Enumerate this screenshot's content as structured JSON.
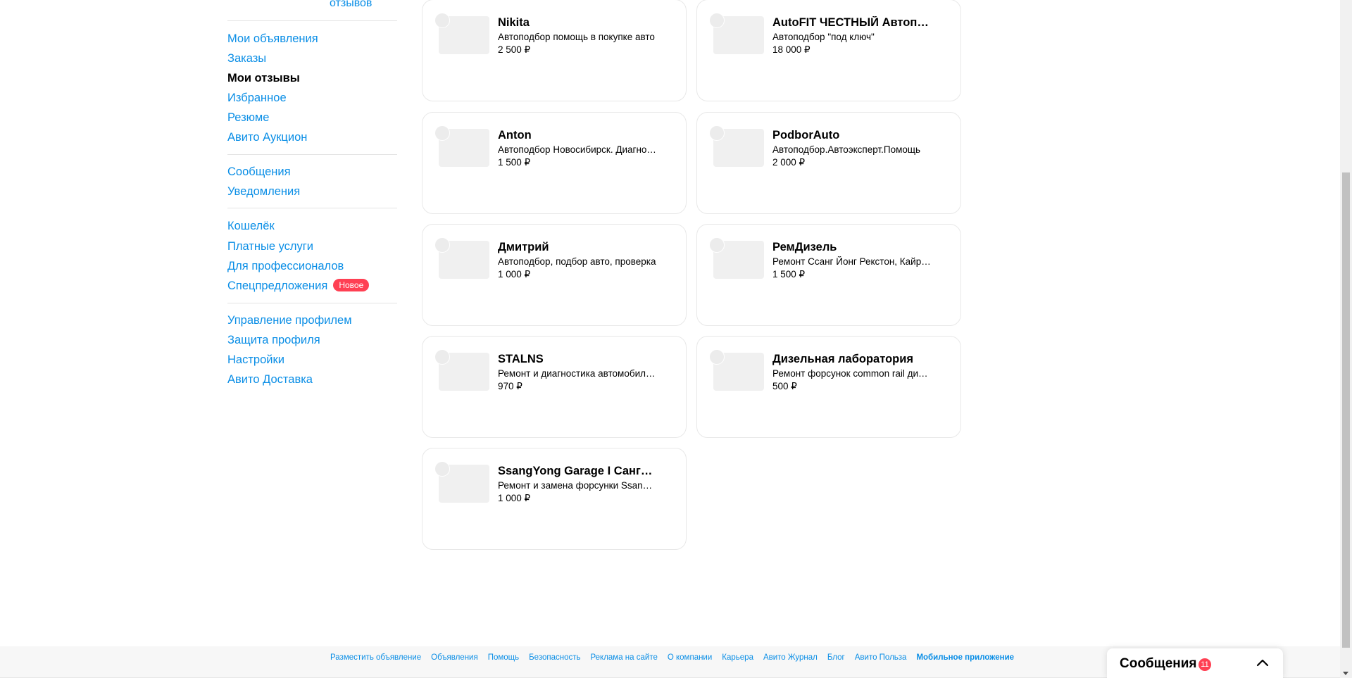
{
  "sidebar": {
    "top_fragment": "отзывов",
    "groups": [
      [
        "Мои объявления",
        "Заказы",
        "Мои отзывы",
        "Избранное",
        "Резюме",
        "Авито Аукцион"
      ],
      [
        "Сообщения",
        "Уведомления"
      ],
      [
        "Кошелёк",
        "Платные услуги",
        "Для профессионалов",
        "Спецпредложения"
      ],
      [
        "Управление профилем",
        "Защита профиля",
        "Настройки",
        "Авито Доставка"
      ]
    ],
    "active_item": "Мои отзывы",
    "new_badge": "Новое"
  },
  "cards": [
    {
      "name": "Nikita",
      "desc": "Автоподбор помощь в покупке авто",
      "price": "2 500 ₽"
    },
    {
      "name": "AutoFIT ЧЕСТНЫЙ Автоподбор",
      "desc": "Автоподбор \"под ключ\"",
      "price": "18 000 ₽"
    },
    {
      "name": "Anton",
      "desc": "Автоподбор Новосибирск. Диагностика",
      "price": "1 500 ₽"
    },
    {
      "name": "PodborAuto",
      "desc": "Автоподбор.Автоэксперт.Помощь",
      "price": "2 000 ₽"
    },
    {
      "name": "Дмитрий",
      "desc": "Автоподбор, подбор авто, проверка",
      "price": "1 000 ₽"
    },
    {
      "name": "РемДизель",
      "desc": "Ремонт Ссанг Йонг Рекстон, Кайрон",
      "price": "1 500 ₽"
    },
    {
      "name": "STALNS",
      "desc": "Ремонт и диагностика автомобилей",
      "price": "970 ₽"
    },
    {
      "name": "Дизельная лаборатория",
      "desc": "Ремонт форсунок common rail дизель",
      "price": "500 ₽"
    },
    {
      "name": "SsangYong Garage I СангЁнг Гараж",
      "desc": "Ремонт и замена форсунки SsangYong",
      "price": "1 000 ₽"
    }
  ],
  "footer": {
    "links": [
      "Разместить объявление",
      "Объявления",
      "Помощь",
      "Безопасность",
      "Реклама на сайте",
      "О компании",
      "Карьера",
      "Авито Журнал",
      "Блог",
      "Авито Польза",
      "Мобильное приложение"
    ]
  },
  "messenger": {
    "title": "Сообщения",
    "count": "11"
  },
  "colors": {
    "link": "#0a8ee6",
    "badge": "#ff4053"
  }
}
